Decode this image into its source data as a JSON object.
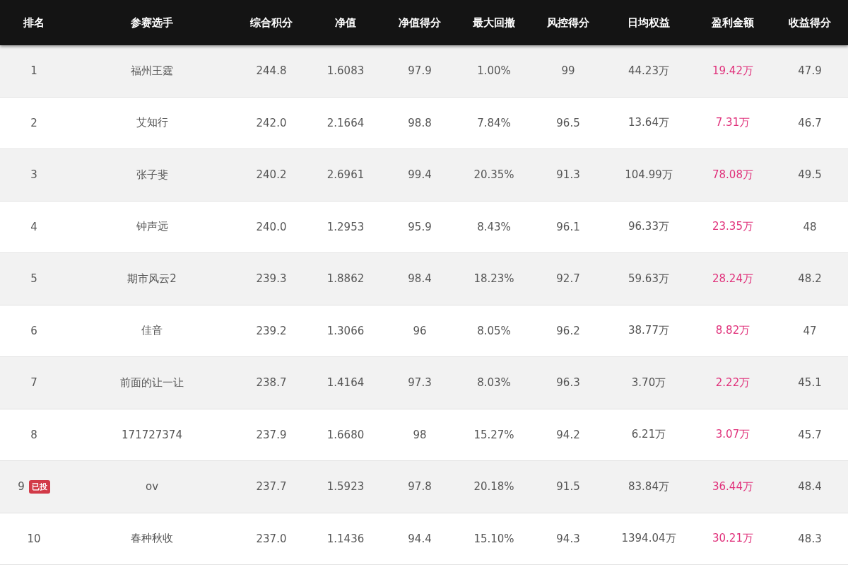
{
  "table": {
    "columns": [
      "排名",
      "参赛选手",
      "综合积分",
      "净值",
      "净值得分",
      "最大回撤",
      "风控得分",
      "日均权益",
      "盈利金额",
      "收益得分"
    ],
    "rows": [
      {
        "cells": [
          "1",
          "福州王霆",
          "244.8",
          "1.6083",
          "97.9",
          "1.00%",
          "99",
          "44.23万",
          "19.42万",
          "47.9"
        ]
      },
      {
        "cells": [
          "2",
          "艾知行",
          "242.0",
          "2.1664",
          "98.8",
          "7.84%",
          "96.5",
          "13.64万",
          "7.31万",
          "46.7"
        ]
      },
      {
        "cells": [
          "3",
          "张子斐",
          "240.2",
          "2.6961",
          "99.4",
          "20.35%",
          "91.3",
          "104.99万",
          "78.08万",
          "49.5"
        ]
      },
      {
        "cells": [
          "4",
          "钟声远",
          "240.0",
          "1.2953",
          "95.9",
          "8.43%",
          "96.1",
          "96.33万",
          "23.35万",
          "48"
        ]
      },
      {
        "cells": [
          "5",
          "期市风云2",
          "239.3",
          "1.8862",
          "98.4",
          "18.23%",
          "92.7",
          "59.63万",
          "28.24万",
          "48.2"
        ]
      },
      {
        "cells": [
          "6",
          "佳音",
          "239.2",
          "1.3066",
          "96",
          "8.05%",
          "96.2",
          "38.77万",
          "8.82万",
          "47"
        ]
      },
      {
        "cells": [
          "7",
          "前面的让一让",
          "238.7",
          "1.4164",
          "97.3",
          "8.03%",
          "96.3",
          "3.70万",
          "2.22万",
          "45.1"
        ]
      },
      {
        "cells": [
          "8",
          "171727374",
          "237.9",
          "1.6680",
          "98",
          "15.27%",
          "94.2",
          "6.21万",
          "3.07万",
          "45.7"
        ]
      },
      {
        "cells": [
          "9",
          "ov",
          "237.7",
          "1.5923",
          "97.8",
          "20.18%",
          "91.5",
          "83.84万",
          "36.44万",
          "48.4"
        ],
        "badge": "已投"
      },
      {
        "cells": [
          "10",
          "春种秋收",
          "237.0",
          "1.1436",
          "94.4",
          "15.10%",
          "94.3",
          "1394.04万",
          "30.21万",
          "48.3"
        ]
      }
    ]
  }
}
